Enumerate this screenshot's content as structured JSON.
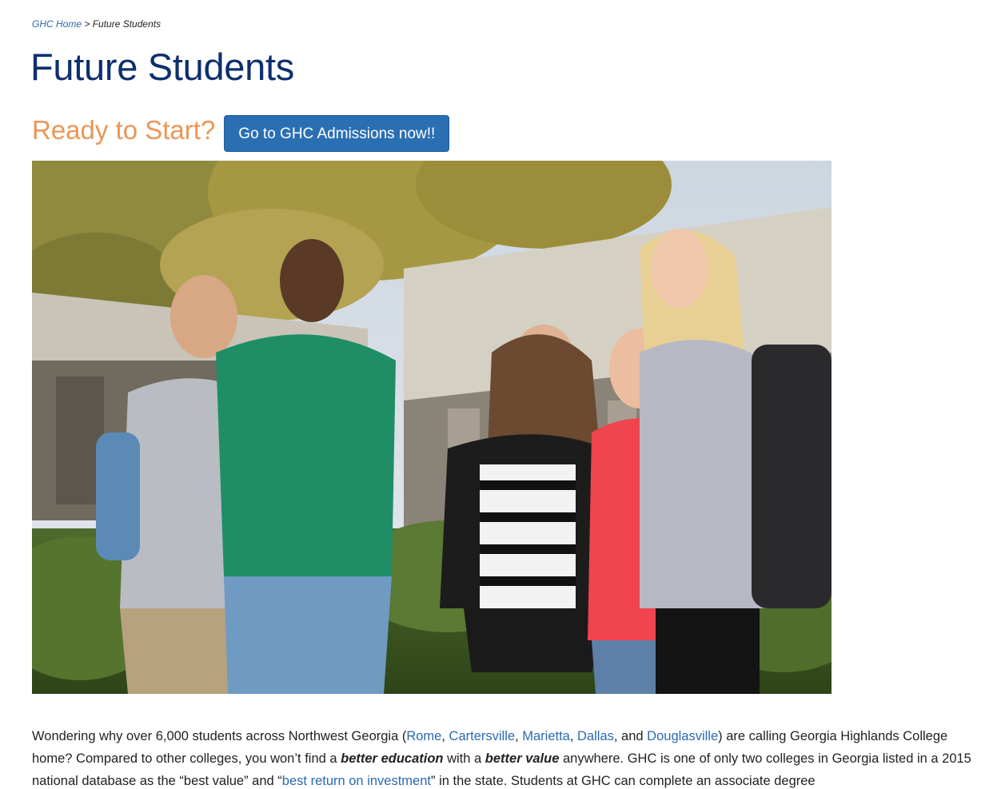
{
  "breadcrumb": {
    "home_label": "GHC Home",
    "separator": " > ",
    "current": "Future Students"
  },
  "page_title": "Future Students",
  "ready": {
    "heading": "Ready to Start?",
    "button_label": "Go to GHC Admissions now!!"
  },
  "hero_image": {
    "alt": "Five smiling Georgia Highlands College students standing outside a campus building"
  },
  "intro": {
    "t1": "Wondering why over 6,000 students across Northwest Georgia (",
    "campus_rome": "Rome",
    "sep1": ", ",
    "campus_cartersville": "Cartersville",
    "sep2": ", ",
    "campus_marietta": "Marietta",
    "sep3": ", ",
    "campus_dallas": "Dallas",
    "sep4": ", and ",
    "campus_douglasville": "Douglasville",
    "t2": ") are calling Georgia Highlands College home? Compared to other colleges, you won’t find a ",
    "bold1": "better education",
    "t3": " with a ",
    "bold2": "better value",
    "t4": " anywhere. GHC is one of only two colleges in Georgia listed in a 2015 national database as the “best value” and “",
    "link_roi": "best return on investment",
    "t5": "” in the state. Students at GHC can complete an associate degree"
  },
  "colors": {
    "title": "#0e2f6e",
    "accent_orange": "#ec9556",
    "button_blue": "#2b6fb3",
    "link_blue": "#2a6ab0"
  }
}
